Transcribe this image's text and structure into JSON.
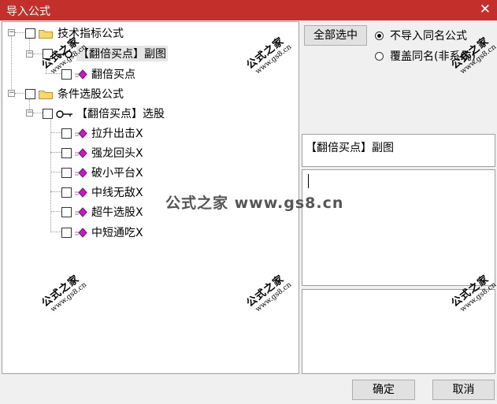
{
  "window": {
    "title": "导入公式",
    "close_glyph": "✕"
  },
  "tree": {
    "group1": {
      "label": "技术指标公式",
      "children": [
        {
          "label": "【翻倍买点】副图",
          "children": [
            {
              "label": "翻倍买点"
            }
          ]
        }
      ]
    },
    "group2": {
      "label": "条件选股公式",
      "children": [
        {
          "label": "【翻倍买点】选股",
          "children": [
            {
              "label": "拉升出击X"
            },
            {
              "label": "强龙回头X"
            },
            {
              "label": "破小平台X"
            },
            {
              "label": "中线无敌X"
            },
            {
              "label": "超牛选股X"
            },
            {
              "label": "中短通吃X"
            }
          ]
        }
      ]
    }
  },
  "options": {
    "select_all_label": "全部选中",
    "radio1_label": "不导入同名公式",
    "radio2_label": "覆盖同名(非系统)",
    "selected": "radio1"
  },
  "info": {
    "formula_name": "【翻倍买点】副图",
    "description": "",
    "note": ""
  },
  "footer": {
    "ok_label": "确定",
    "cancel_label": "取消"
  },
  "watermark": {
    "big": "公式之家",
    "small": "www.gs8.cn",
    "center": "公式之家 www.gs8.cn"
  },
  "colors": {
    "titlebar": "#c3302c",
    "folder": "#f5d76e",
    "gem": "#c818c8"
  }
}
